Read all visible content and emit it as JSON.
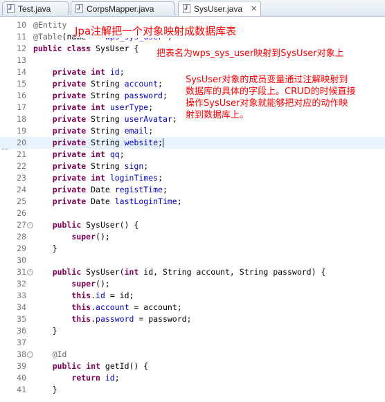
{
  "tabs": [
    {
      "label": "Test.java",
      "active": false
    },
    {
      "label": "CorpsMapper.java",
      "active": false
    },
    {
      "label": "SysUser.java",
      "active": true
    }
  ],
  "colors": {
    "keyword": "#7f0055",
    "field": "#0000c0",
    "string": "#2a00ff",
    "annotation": "#646464",
    "note": "#ff0000"
  },
  "editor": {
    "current_line": 20,
    "lines": [
      {
        "n": 10,
        "fold": false,
        "tokens": [
          [
            "ann",
            "@Entity"
          ]
        ]
      },
      {
        "n": 11,
        "fold": false,
        "tokens": [
          [
            "ann",
            "@Table"
          ],
          [
            "",
            "(name = "
          ],
          [
            "str",
            "\"wps_sys_user\""
          ],
          [
            "",
            ")"
          ]
        ]
      },
      {
        "n": 12,
        "fold": false,
        "tokens": [
          [
            "kw",
            "public"
          ],
          [
            "",
            " "
          ],
          [
            "kw",
            "class"
          ],
          [
            "",
            " SysUser {"
          ]
        ]
      },
      {
        "n": 13,
        "fold": false,
        "tokens": []
      },
      {
        "n": 14,
        "fold": false,
        "tokens": [
          [
            "",
            "    "
          ],
          [
            "kw",
            "private"
          ],
          [
            "",
            " "
          ],
          [
            "kw",
            "int"
          ],
          [
            "",
            " "
          ],
          [
            "field",
            "id"
          ],
          [
            "",
            ";"
          ]
        ]
      },
      {
        "n": 15,
        "fold": false,
        "tokens": [
          [
            "",
            "    "
          ],
          [
            "kw",
            "private"
          ],
          [
            "",
            " String "
          ],
          [
            "field",
            "account"
          ],
          [
            "",
            ";"
          ]
        ]
      },
      {
        "n": 16,
        "fold": false,
        "tokens": [
          [
            "",
            "    "
          ],
          [
            "kw",
            "private"
          ],
          [
            "",
            " String "
          ],
          [
            "field",
            "password"
          ],
          [
            "",
            ";"
          ]
        ]
      },
      {
        "n": 17,
        "fold": false,
        "tokens": [
          [
            "",
            "    "
          ],
          [
            "kw",
            "private"
          ],
          [
            "",
            " "
          ],
          [
            "kw",
            "int"
          ],
          [
            "",
            " "
          ],
          [
            "field",
            "userType"
          ],
          [
            "",
            ";"
          ]
        ]
      },
      {
        "n": 18,
        "fold": false,
        "tokens": [
          [
            "",
            "    "
          ],
          [
            "kw",
            "private"
          ],
          [
            "",
            " String "
          ],
          [
            "field",
            "userAvatar"
          ],
          [
            "",
            ";"
          ]
        ]
      },
      {
        "n": 19,
        "fold": false,
        "tokens": [
          [
            "",
            "    "
          ],
          [
            "kw",
            "private"
          ],
          [
            "",
            " String "
          ],
          [
            "field",
            "email"
          ],
          [
            "",
            ";"
          ]
        ]
      },
      {
        "n": 20,
        "fold": false,
        "tokens": [
          [
            "",
            "    "
          ],
          [
            "kw",
            "private"
          ],
          [
            "",
            " String "
          ],
          [
            "field",
            "website"
          ],
          [
            "",
            ";"
          ]
        ],
        "cursor": true
      },
      {
        "n": 21,
        "fold": false,
        "tokens": [
          [
            "",
            "    "
          ],
          [
            "kw",
            "private"
          ],
          [
            "",
            " "
          ],
          [
            "kw",
            "int"
          ],
          [
            "",
            " "
          ],
          [
            "field",
            "qq"
          ],
          [
            "",
            ";"
          ]
        ]
      },
      {
        "n": 22,
        "fold": false,
        "tokens": [
          [
            "",
            "    "
          ],
          [
            "kw",
            "private"
          ],
          [
            "",
            " String "
          ],
          [
            "field",
            "sign"
          ],
          [
            "",
            ";"
          ]
        ]
      },
      {
        "n": 23,
        "fold": false,
        "tokens": [
          [
            "",
            "    "
          ],
          [
            "kw",
            "private"
          ],
          [
            "",
            " "
          ],
          [
            "kw",
            "int"
          ],
          [
            "",
            " "
          ],
          [
            "field",
            "loginTimes"
          ],
          [
            "",
            ";"
          ]
        ]
      },
      {
        "n": 24,
        "fold": false,
        "tokens": [
          [
            "",
            "    "
          ],
          [
            "kw",
            "private"
          ],
          [
            "",
            " Date "
          ],
          [
            "field",
            "registTime"
          ],
          [
            "",
            ";"
          ]
        ]
      },
      {
        "n": 25,
        "fold": false,
        "tokens": [
          [
            "",
            "    "
          ],
          [
            "kw",
            "private"
          ],
          [
            "",
            " Date "
          ],
          [
            "field",
            "lastLoginTime"
          ],
          [
            "",
            ";"
          ]
        ]
      },
      {
        "n": 26,
        "fold": false,
        "tokens": []
      },
      {
        "n": 27,
        "fold": true,
        "tokens": [
          [
            "",
            "    "
          ],
          [
            "kw",
            "public"
          ],
          [
            "",
            " SysUser() {"
          ]
        ]
      },
      {
        "n": 28,
        "fold": false,
        "tokens": [
          [
            "",
            "        "
          ],
          [
            "kw",
            "super"
          ],
          [
            "",
            "();"
          ]
        ]
      },
      {
        "n": 29,
        "fold": false,
        "tokens": [
          [
            "",
            "    }"
          ]
        ]
      },
      {
        "n": 30,
        "fold": false,
        "tokens": []
      },
      {
        "n": 31,
        "fold": true,
        "tokens": [
          [
            "",
            "    "
          ],
          [
            "kw",
            "public"
          ],
          [
            "",
            " SysUser("
          ],
          [
            "kw",
            "int"
          ],
          [
            "",
            " id, String account, String password) {"
          ]
        ]
      },
      {
        "n": 32,
        "fold": false,
        "tokens": [
          [
            "",
            "        "
          ],
          [
            "kw",
            "super"
          ],
          [
            "",
            "();"
          ]
        ]
      },
      {
        "n": 33,
        "fold": false,
        "tokens": [
          [
            "",
            "        "
          ],
          [
            "kw",
            "this"
          ],
          [
            "",
            "."
          ],
          [
            "field",
            "id"
          ],
          [
            "",
            " = id;"
          ]
        ]
      },
      {
        "n": 34,
        "fold": false,
        "tokens": [
          [
            "",
            "        "
          ],
          [
            "kw",
            "this"
          ],
          [
            "",
            "."
          ],
          [
            "field",
            "account"
          ],
          [
            "",
            " = account;"
          ]
        ]
      },
      {
        "n": 35,
        "fold": false,
        "tokens": [
          [
            "",
            "        "
          ],
          [
            "kw",
            "this"
          ],
          [
            "",
            "."
          ],
          [
            "field",
            "password"
          ],
          [
            "",
            " = password;"
          ]
        ]
      },
      {
        "n": 36,
        "fold": false,
        "tokens": [
          [
            "",
            "    }"
          ]
        ]
      },
      {
        "n": 37,
        "fold": false,
        "tokens": []
      },
      {
        "n": 38,
        "fold": true,
        "tokens": [
          [
            "",
            "    "
          ],
          [
            "ann",
            "@Id"
          ]
        ]
      },
      {
        "n": 39,
        "fold": false,
        "tokens": [
          [
            "",
            "    "
          ],
          [
            "kw",
            "public"
          ],
          [
            "",
            " "
          ],
          [
            "kw",
            "int"
          ],
          [
            "",
            " getId() {"
          ]
        ]
      },
      {
        "n": 40,
        "fold": false,
        "tokens": [
          [
            "",
            "        "
          ],
          [
            "kw",
            "return"
          ],
          [
            "",
            " "
          ],
          [
            "field",
            "id"
          ],
          [
            "",
            ";"
          ]
        ]
      },
      {
        "n": 41,
        "fold": false,
        "tokens": [
          [
            "",
            "    }"
          ]
        ]
      }
    ]
  },
  "notes": {
    "entity_note": "Jpa注解把一个对象映射成数据库表",
    "table_note": "把表名为wps_sys_user映射到SysUser对象上",
    "fields_note_1": "SysUser对象的成员变量通过注解映射到",
    "fields_note_2": "数据库的具体的字段上。CRUD的时候直接",
    "fields_note_3": "操作SysUser对象就能够把对应的动作映",
    "fields_note_4": "射到数据库上。"
  }
}
